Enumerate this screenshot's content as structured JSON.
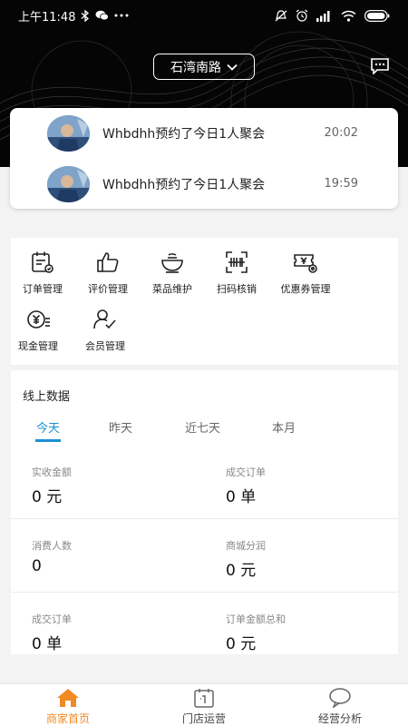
{
  "status_bar": {
    "time": "上午11:48",
    "battery": ""
  },
  "header": {
    "store_name": "石湾南路"
  },
  "notifications": [
    {
      "text": "Whbdhh预约了今日1人聚会",
      "time": "20:02"
    },
    {
      "text": "Whbdhh预约了今日1人聚会",
      "time": "19:59"
    }
  ],
  "tools": [
    {
      "label": "订单管理",
      "icon": "order-icon"
    },
    {
      "label": "评价管理",
      "icon": "thumbs-up-icon"
    },
    {
      "label": "菜品维护",
      "icon": "bowl-icon"
    },
    {
      "label": "扫码核销",
      "icon": "scan-icon"
    },
    {
      "label": "优惠券管理",
      "icon": "coupon-icon"
    },
    {
      "label": "现金管理",
      "icon": "cash-icon"
    },
    {
      "label": "会员管理",
      "icon": "member-icon"
    }
  ],
  "online_data": {
    "title": "线上数据",
    "tabs": [
      "今天",
      "昨天",
      "近七天",
      "本月"
    ],
    "active_tab": "今天",
    "stats": [
      {
        "label": "实收金额",
        "value": "0 元"
      },
      {
        "label": "成交订单",
        "value": "0 单"
      },
      {
        "label": "消费人数",
        "value": "0"
      },
      {
        "label": "商城分润",
        "value": "0 元"
      },
      {
        "label": "成交订单",
        "value": "0 单"
      },
      {
        "label": "订单金额总和",
        "value": "0 元"
      }
    ]
  },
  "bottom_nav": [
    {
      "label": "商家首页",
      "icon": "home-icon",
      "active": true
    },
    {
      "label": "门店运营",
      "icon": "calendar-icon",
      "active": false
    },
    {
      "label": "经营分析",
      "icon": "chat-bubble-icon",
      "active": false
    }
  ],
  "colors": {
    "accent": "#1a8fd6",
    "nav_active": "#f08a24",
    "hero_bg": "#050505"
  }
}
